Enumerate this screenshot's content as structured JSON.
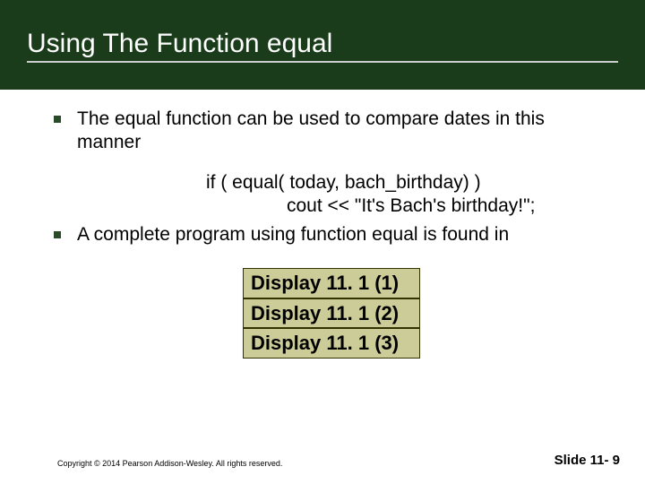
{
  "title": "Using The Function equal",
  "bullets": [
    "The equal function can be used to compare dates in this manner",
    "A complete program using function equal is found in"
  ],
  "code": {
    "line1": "if ( equal( today,  bach_birthday) )",
    "line2": "cout << \"It's Bach's birthday!\";"
  },
  "displays": [
    "Display 11. 1 (1)",
    "Display 11. 1 (2)",
    "Display 11. 1 (3)"
  ],
  "footer": {
    "copyright": "Copyright © 2014 Pearson Addison-Wesley.  All rights reserved.",
    "slide": "Slide 11- 9"
  }
}
